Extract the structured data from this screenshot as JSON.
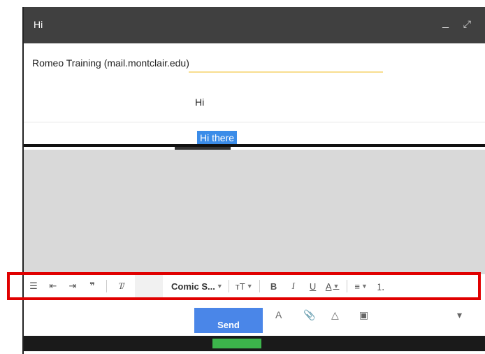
{
  "window": {
    "title": "Hi",
    "minimize_icon": "minimize-icon",
    "popout_icon": "popout-icon"
  },
  "compose": {
    "to": "Romeo Training (mail.montclair.edu)",
    "subject": "Hi",
    "body_selected": "Hi there"
  },
  "toolbar": {
    "font_name": "Comic S...",
    "bold": "B",
    "italic": "I",
    "underline": "U",
    "text_color": "A"
  },
  "footer": {
    "send_label": "Send"
  },
  "colors": {
    "titlebar": "#404040",
    "selection": "#3b8ce8",
    "send_button": "#4a86e8",
    "highlight": "#e00000"
  }
}
